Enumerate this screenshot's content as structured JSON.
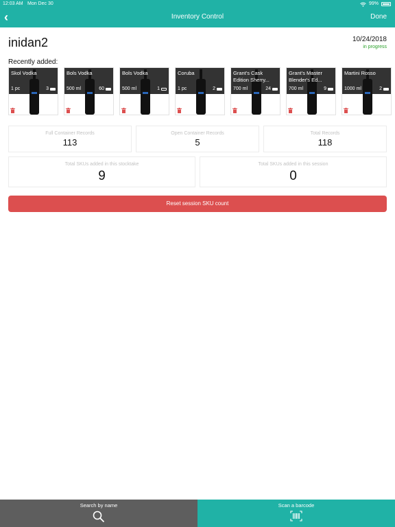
{
  "status_bar": {
    "time": "12:03 AM",
    "date": "Mon Dec 30",
    "battery": "99%"
  },
  "nav": {
    "title": "Inventory Control",
    "done_label": "Done"
  },
  "header": {
    "user": "inidan2",
    "date": "10/24/2018",
    "status": "in progress"
  },
  "recent": {
    "label": "Recently added:",
    "items": [
      {
        "name": "Skol Vodka",
        "size": "1 pc",
        "qty": "3"
      },
      {
        "name": "Bols Vodka",
        "size": "500 ml",
        "qty": "60"
      },
      {
        "name": "Bols Vodka",
        "size": "500 ml",
        "qty": "1"
      },
      {
        "name": "Coruba",
        "size": "1 pc",
        "qty": "2"
      },
      {
        "name": "Grant's Cask Edition Sherry...",
        "size": "700 ml",
        "qty": "24"
      },
      {
        "name": "Grant's Master Blender's Ed...",
        "size": "700 ml",
        "qty": "9"
      },
      {
        "name": "Martini Rosso",
        "size": "1000 ml",
        "qty": "2"
      }
    ]
  },
  "stats": {
    "full": {
      "label": "Full Container Records",
      "value": "113"
    },
    "open": {
      "label": "Open Container Records",
      "value": "5"
    },
    "total": {
      "label": "Total Records",
      "value": "118"
    },
    "stocktake": {
      "label": "Total SKUs added in this stocktake",
      "value": "9"
    },
    "session": {
      "label": "Total SKUs added in this session",
      "value": "0"
    }
  },
  "reset_label": "Reset session SKU count",
  "bottom": {
    "search_label": "Search by name",
    "scan_label": "Scan a barcode"
  },
  "colors": {
    "accent": "#20b2a6",
    "danger": "#dc4f4f",
    "bottom_dark": "#5e5e5e",
    "status_green": "#2aa12a"
  }
}
